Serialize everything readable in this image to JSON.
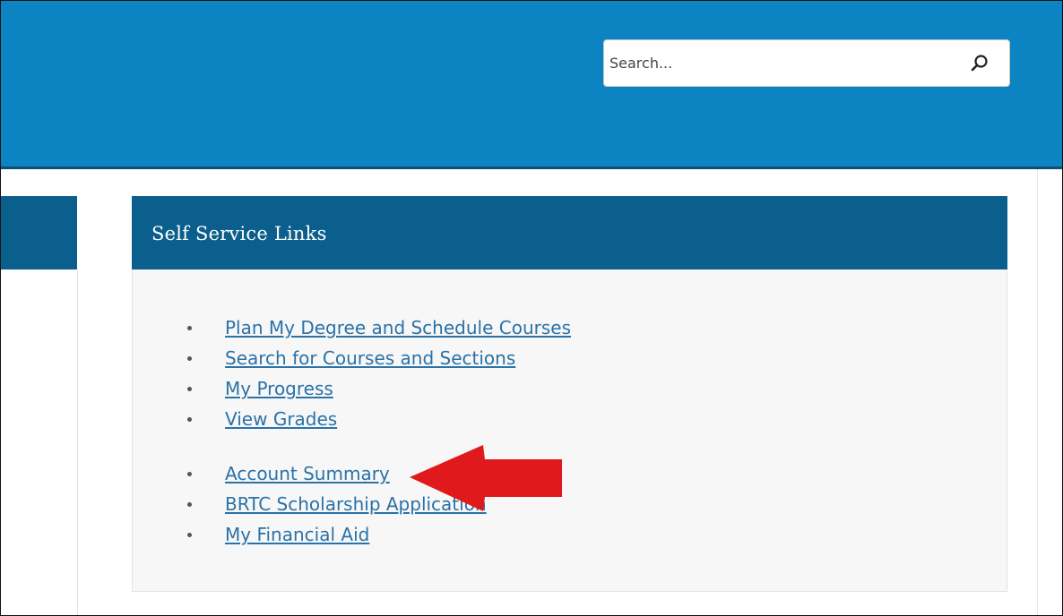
{
  "search": {
    "placeholder": "Search..."
  },
  "panel": {
    "title": "Self Service Links"
  },
  "links": {
    "items": [
      {
        "label": "Plan My Degree and Schedule Courses"
      },
      {
        "label": "Search for Courses and Sections"
      },
      {
        "label": "My Progress"
      },
      {
        "label": "View Grades"
      },
      {
        "label": "Account Summary"
      },
      {
        "label": "BRTC Scholarship Application"
      },
      {
        "label": "My Financial Aid"
      }
    ]
  },
  "colors": {
    "header_blue": "#0c84c2",
    "panel_header": "#0a5f8c",
    "link_color": "#2a72a8",
    "arrow_red": "#e0191d"
  },
  "icons": {
    "search": "search-icon",
    "annotation": "red-arrow-annotation"
  }
}
